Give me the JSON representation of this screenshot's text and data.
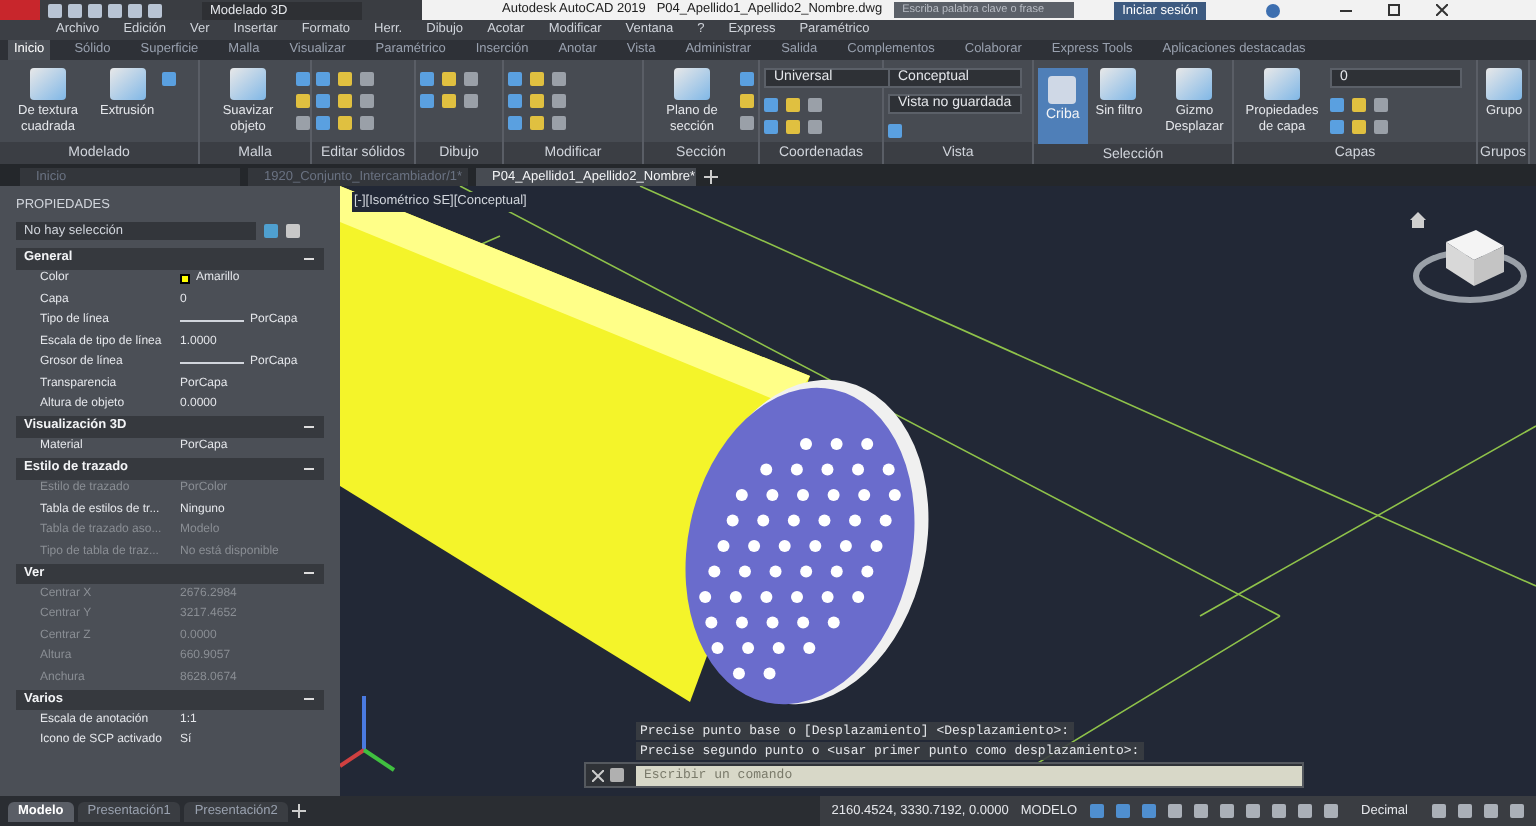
{
  "title_bar": {
    "workspace": "Modelado 3D",
    "title": "Autodesk AutoCAD 2019   P04_Apellido1_Apellido2_Nombre.dwg",
    "search_placeholder": "Escriba palabra clave o frase",
    "sign_in": "Iniciar sesión"
  },
  "menu_bar": [
    "Archivo",
    "Edición",
    "Ver",
    "Insertar",
    "Formato",
    "Herr.",
    "Dibujo",
    "Acotar",
    "Modificar",
    "Ventana",
    "?",
    "Express",
    "Paramétrico"
  ],
  "ribbon_tabs": [
    {
      "label": "Inicio",
      "selected": true
    },
    {
      "label": "Sólido",
      "selected": false
    },
    {
      "label": "Superficie",
      "selected": false
    },
    {
      "label": "Malla",
      "selected": false
    },
    {
      "label": "Visualizar",
      "selected": false
    },
    {
      "label": "Paramétrico",
      "selected": false
    },
    {
      "label": "Inserción",
      "selected": false
    },
    {
      "label": "Anotar",
      "selected": false
    },
    {
      "label": "Vista",
      "selected": false
    },
    {
      "label": "Administrar",
      "selected": false
    },
    {
      "label": "Salida",
      "selected": false
    },
    {
      "label": "Complementos",
      "selected": false
    },
    {
      "label": "Colaborar",
      "selected": false
    },
    {
      "label": "Express Tools",
      "selected": false
    },
    {
      "label": "Aplicaciones destacadas",
      "selected": false
    }
  ],
  "ribbon_panels": [
    {
      "title": "Modelado",
      "tools": [
        {
          "kind": "large",
          "label": "De textura cuadrada"
        },
        {
          "kind": "large",
          "label": "Extrusión"
        }
      ]
    },
    {
      "title": "Malla",
      "tools": [
        {
          "kind": "large",
          "label": "Suavizar objeto"
        }
      ]
    },
    {
      "title": "Editar sólidos"
    },
    {
      "title": "Dibujo"
    },
    {
      "title": "Modificar"
    },
    {
      "title": "Sección",
      "tools": [
        {
          "kind": "large",
          "label": "Plano de sección"
        }
      ]
    },
    {
      "title": "Coordenadas",
      "tools": [
        {
          "kind": "dropdown",
          "value": "Universal"
        }
      ]
    },
    {
      "title": "Vista",
      "tools": [
        {
          "kind": "dropdown",
          "value": "Conceptual"
        },
        {
          "kind": "dropdown",
          "value": "Vista no guardada"
        }
      ]
    },
    {
      "title": "Selección",
      "tools": [
        {
          "kind": "toggle",
          "label": "Criba",
          "selected": true
        },
        {
          "kind": "large",
          "label": "Sin filtro"
        },
        {
          "kind": "large",
          "label": "Gizmo Desplazar"
        }
      ]
    },
    {
      "title": "Capas",
      "tools": [
        {
          "kind": "large",
          "label": "Propiedades de capa"
        },
        {
          "kind": "dropdown",
          "value": "0"
        }
      ]
    },
    {
      "title": "Grupos",
      "tools": [
        {
          "kind": "large",
          "label": "Grupo"
        }
      ]
    }
  ],
  "file_tabs": [
    {
      "label": "Inicio",
      "selected": false
    },
    {
      "label": "1920_Conjunto_Intercambiador/1*",
      "selected": false
    },
    {
      "label": "P04_Apellido1_Apellido2_Nombre*",
      "selected": true
    }
  ],
  "properties": {
    "title": "PROPIEDADES",
    "selection": "No hay selección",
    "sections": [
      {
        "title": "General",
        "expanded": true,
        "rows": [
          {
            "label": "Color",
            "value": "Amarillo",
            "kind": "swatch",
            "color": "#ffff00",
            "disabled": false
          },
          {
            "label": "Capa",
            "value": "0",
            "kind": "text",
            "disabled": false
          },
          {
            "label": "Tipo de línea",
            "value": "PorCapa",
            "kind": "line",
            "disabled": false
          },
          {
            "label": "Escala de tipo de línea",
            "value": "1.0000",
            "kind": "text",
            "disabled": false
          },
          {
            "label": "Grosor de línea",
            "value": "PorCapa",
            "kind": "line",
            "disabled": false
          },
          {
            "label": "Transparencia",
            "value": "PorCapa",
            "kind": "text",
            "disabled": false
          },
          {
            "label": "Altura de objeto",
            "value": "0.0000",
            "kind": "text",
            "disabled": false
          }
        ]
      },
      {
        "title": "Visualización 3D",
        "expanded": true,
        "rows": [
          {
            "label": "Material",
            "value": "PorCapa",
            "kind": "text",
            "disabled": false
          }
        ]
      },
      {
        "title": "Estilo de trazado",
        "expanded": true,
        "rows": [
          {
            "label": "Estilo de trazado",
            "value": "PorColor",
            "kind": "text",
            "disabled": true
          },
          {
            "label": "Tabla de estilos de tr...",
            "value": "Ninguno",
            "kind": "text",
            "disabled": false
          },
          {
            "label": "Tabla de trazado aso...",
            "value": "Modelo",
            "kind": "text",
            "disabled": true
          },
          {
            "label": "Tipo de tabla de traz...",
            "value": "No está disponible",
            "kind": "text",
            "disabled": true
          }
        ]
      },
      {
        "title": "Ver",
        "expanded": true,
        "rows": [
          {
            "label": "Centrar X",
            "value": "2676.2984",
            "kind": "text",
            "disabled": true
          },
          {
            "label": "Centrar Y",
            "value": "3217.4652",
            "kind": "text",
            "disabled": true
          },
          {
            "label": "Centrar Z",
            "value": "0.0000",
            "kind": "text",
            "disabled": true
          },
          {
            "label": "Altura",
            "value": "660.9057",
            "kind": "text",
            "disabled": true
          },
          {
            "label": "Anchura",
            "value": "8628.0674",
            "kind": "text",
            "disabled": true
          }
        ]
      },
      {
        "title": "Varios",
        "expanded": true,
        "rows": [
          {
            "label": "Escala de anotación",
            "value": "1:1",
            "kind": "text",
            "disabled": false
          },
          {
            "label": "Icono de SCP activado",
            "value": "Sí",
            "kind": "text",
            "disabled": false
          }
        ]
      }
    ]
  },
  "viewport": {
    "label": "[-][Isométrico SE][Conceptual]"
  },
  "command_line": {
    "history": [
      "Precise punto base o [Desplazamiento] <Desplazamiento>:",
      "Precise segundo punto o <usar primer punto como desplazamiento>:"
    ],
    "placeholder": "Escribir un comando"
  },
  "layout_tabs": [
    {
      "label": "Modelo",
      "selected": true
    },
    {
      "label": "Presentación1",
      "selected": false
    },
    {
      "label": "Presentación2",
      "selected": false
    }
  ],
  "status_bar": {
    "coordinates": "2160.4524, 3330.7192, 0.0000",
    "space": "MODELO",
    "units": "Decimal"
  }
}
